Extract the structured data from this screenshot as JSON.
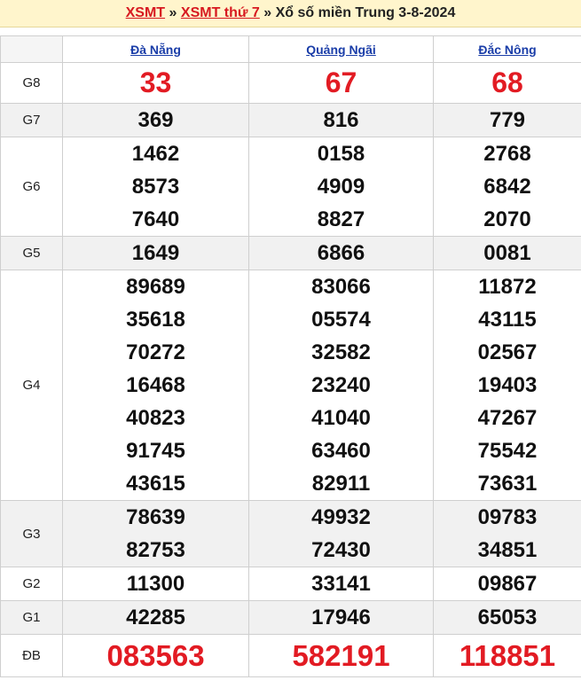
{
  "header": {
    "link1": "XSMT",
    "sep1": "»",
    "link2": "XSMT thứ 7",
    "sep2": "»",
    "title": "Xổ số miền Trung 3-8-2024"
  },
  "provinces": [
    "Đà Nẵng",
    "Quảng Ngãi",
    "Đắc Nông"
  ],
  "prizes": [
    {
      "label": "G8",
      "values": [
        [
          "33"
        ],
        [
          "67"
        ],
        [
          "68"
        ]
      ]
    },
    {
      "label": "G7",
      "values": [
        [
          "369"
        ],
        [
          "816"
        ],
        [
          "779"
        ]
      ]
    },
    {
      "label": "G6",
      "values": [
        [
          "1462",
          "8573",
          "7640"
        ],
        [
          "0158",
          "4909",
          "8827"
        ],
        [
          "2768",
          "6842",
          "2070"
        ]
      ]
    },
    {
      "label": "G5",
      "values": [
        [
          "1649"
        ],
        [
          "6866"
        ],
        [
          "0081"
        ]
      ]
    },
    {
      "label": "G4",
      "values": [
        [
          "89689",
          "35618",
          "70272",
          "16468",
          "40823",
          "91745",
          "43615"
        ],
        [
          "83066",
          "05574",
          "32582",
          "23240",
          "41040",
          "63460",
          "82911"
        ],
        [
          "11872",
          "43115",
          "02567",
          "19403",
          "47267",
          "75542",
          "73631"
        ]
      ]
    },
    {
      "label": "G3",
      "values": [
        [
          "78639",
          "82753"
        ],
        [
          "49932",
          "72430"
        ],
        [
          "09783",
          "34851"
        ]
      ]
    },
    {
      "label": "G2",
      "values": [
        [
          "11300"
        ],
        [
          "33141"
        ],
        [
          "09867"
        ]
      ]
    },
    {
      "label": "G1",
      "values": [
        [
          "42285"
        ],
        [
          "17946"
        ],
        [
          "65053"
        ]
      ]
    },
    {
      "label": "ĐB",
      "values": [
        [
          "083563"
        ],
        [
          "582191"
        ],
        [
          "118851"
        ]
      ]
    }
  ],
  "colors": {
    "accent_red": "#e21b23",
    "header_bg": "#fff5cc",
    "province_link": "#1a3da8",
    "alt_row": "#f1f1f1"
  }
}
